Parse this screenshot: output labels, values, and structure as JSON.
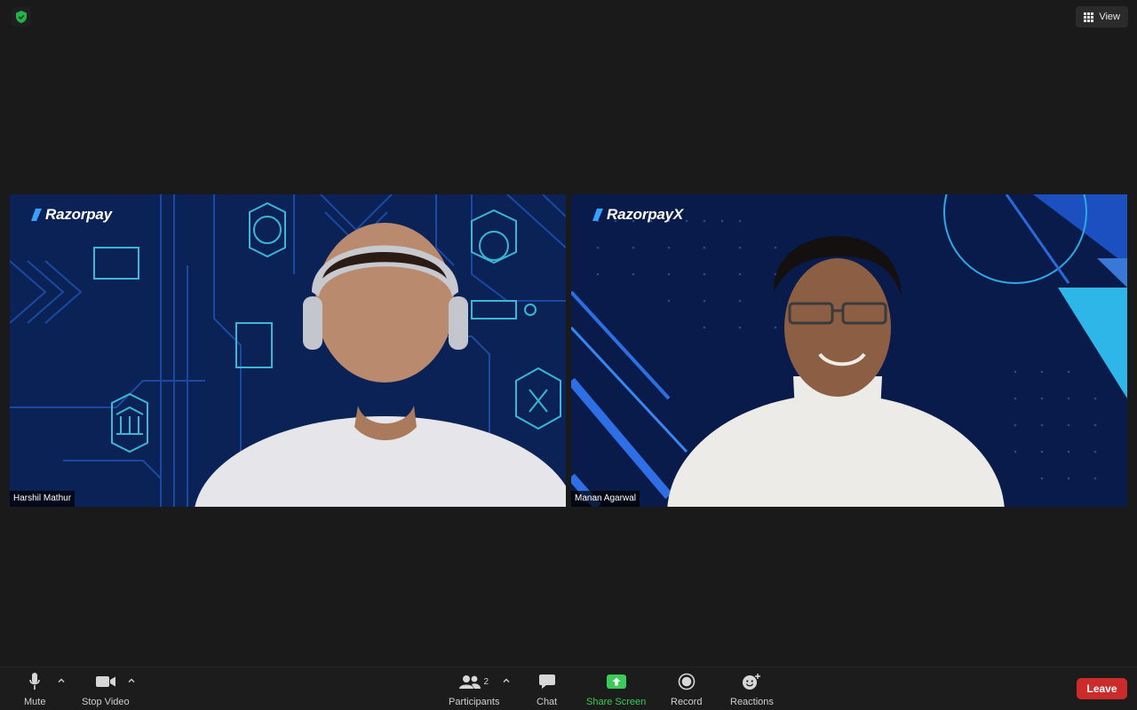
{
  "header": {
    "view_label": "View"
  },
  "participants": [
    {
      "name": "Harshil Mathur",
      "brand": "Razorpay"
    },
    {
      "name": "Manan Agarwal",
      "brand": "RazorpayX"
    }
  ],
  "toolbar": {
    "mute_label": "Mute",
    "stop_video_label": "Stop Video",
    "participants_label": "Participants",
    "participants_count": "2",
    "chat_label": "Chat",
    "share_screen_label": "Share Screen",
    "record_label": "Record",
    "reactions_label": "Reactions",
    "leave_label": "Leave"
  },
  "colors": {
    "background": "#1a1a1a",
    "share_green": "#3ccb5a",
    "leave_red": "#cc2b2b",
    "shield_green": "#23b14d",
    "razorpay_blue": "#0a2259"
  }
}
